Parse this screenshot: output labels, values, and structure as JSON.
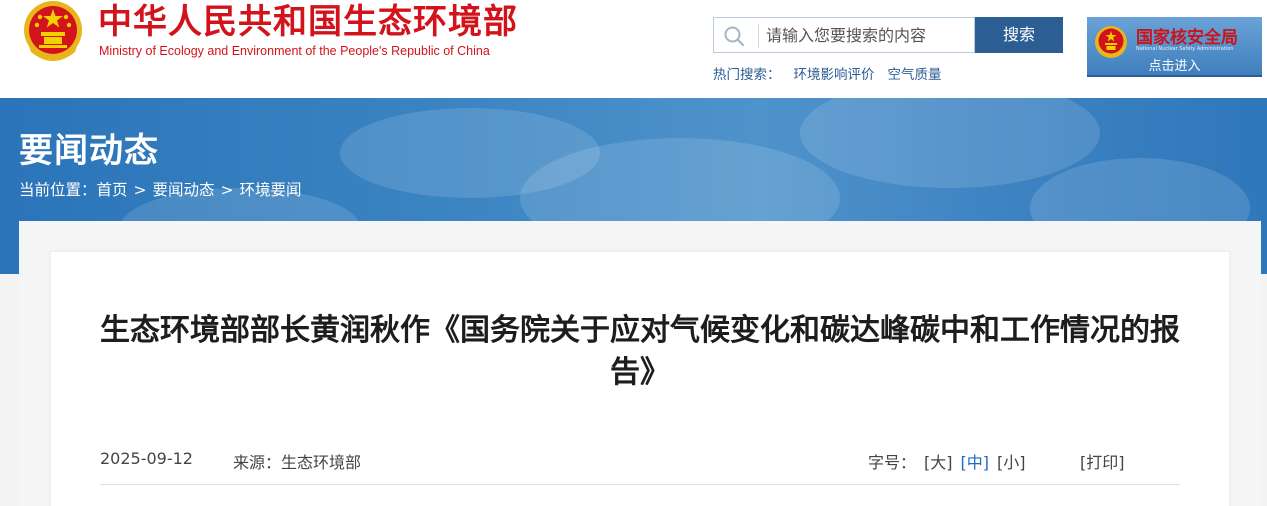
{
  "header": {
    "site_name_cn": "中华人民共和国生态环境部",
    "site_name_en": "Ministry of Ecology and Environment of the People's Republic of China",
    "search": {
      "placeholder": "请输入您要搜索的内容",
      "button_label": "搜索",
      "icon": "search-icon"
    },
    "hot_search": {
      "label": "热门搜索：",
      "items": [
        "环境影响评价",
        "空气质量"
      ]
    },
    "nnsa_link": {
      "title": "国家核安全局",
      "subtitle_en": "National Nuclear Safety Administration",
      "enter_label": "点击进入"
    }
  },
  "banner": {
    "title": "要闻动态",
    "breadcrumb": {
      "prefix": "当前位置：",
      "items": [
        "首页",
        "要闻动态",
        "环境要闻"
      ],
      "separator": ">"
    }
  },
  "article": {
    "title": "生态环境部部长黄润秋作《国务院关于应对气候变化和碳达峰碳中和工作情况的报告》",
    "date": "2025-09-12",
    "source": "来源：生态环境部",
    "font_size": {
      "label": "字号：",
      "options": [
        "[大]",
        "[中]",
        "[小]"
      ],
      "selected": "[中]"
    },
    "print_label": "[打印]"
  },
  "colors": {
    "brand_red": "#d3131b",
    "nav_blue": "#2c5e94",
    "banner_blue": "#3b84c2",
    "active_link": "#1e6bc1"
  }
}
